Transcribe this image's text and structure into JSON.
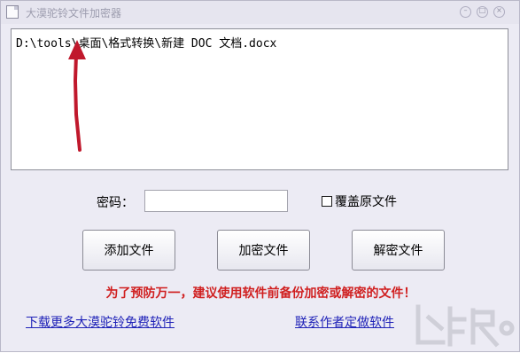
{
  "window": {
    "title": "大漠驼铃文件加密器"
  },
  "file_list": {
    "items": [
      "D:\\tools\\桌面\\格式转换\\新建 DOC 文档.docx"
    ]
  },
  "password": {
    "label": "密码：",
    "value": "",
    "placeholder": ""
  },
  "overwrite": {
    "label": "覆盖原文件",
    "checked": false
  },
  "buttons": {
    "add": "添加文件",
    "encrypt": "加密文件",
    "decrypt": "解密文件"
  },
  "warning": "为了预防万一，建议使用软件前备份加密或解密的文件！",
  "links": {
    "download": "下载更多大漠驼铃免费软件",
    "contact": "联系作者定做软件"
  },
  "colors": {
    "warning": "#d02020",
    "link": "#1f22b8",
    "annotation_arrow": "#c0182c",
    "window_bg": "#ecebf4"
  }
}
